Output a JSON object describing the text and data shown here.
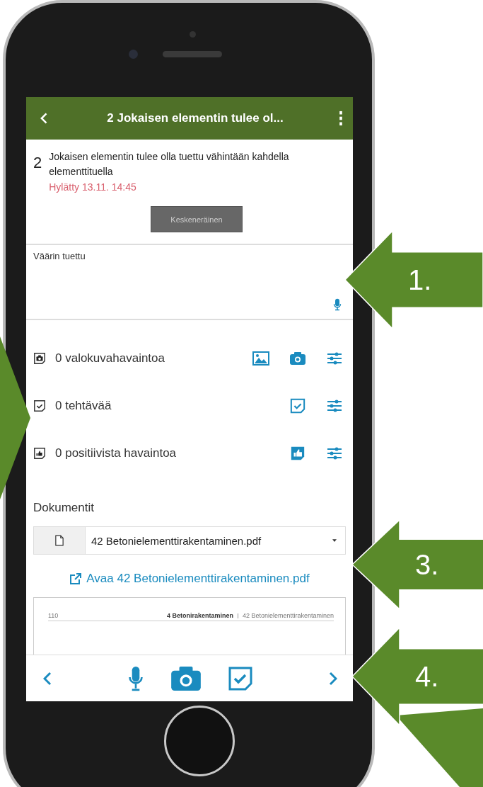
{
  "header": {
    "title": "2 Jokaisen elementin tulee ol..."
  },
  "item": {
    "number": "2",
    "text": "Jokaisen elementin tulee olla tuettu vähintään kahdella elementtituella",
    "status": "Hylätty 13.11. 14:45",
    "button": "Keskeneräinen"
  },
  "comment": {
    "value": "Väärin tuettu"
  },
  "observations": [
    {
      "kind": "photo",
      "label": "0 valokuvahavaintoa"
    },
    {
      "kind": "task",
      "label": "0 tehtävää"
    },
    {
      "kind": "positive",
      "label": "0 positiivista havaintoa"
    }
  ],
  "documents": {
    "title": "Dokumentit",
    "selected_file": "42 Betonielementtirakentaminen.pdf",
    "open_link": "Avaa 42 Betonielementtirakentaminen.pdf",
    "preview": {
      "page_number": "110",
      "chapter": "4  Betonirakentaminen",
      "section": "42 Betonielementtirakentaminen"
    }
  },
  "callouts": [
    {
      "label": "1."
    },
    {
      "label": "3."
    },
    {
      "label": "4."
    }
  ]
}
